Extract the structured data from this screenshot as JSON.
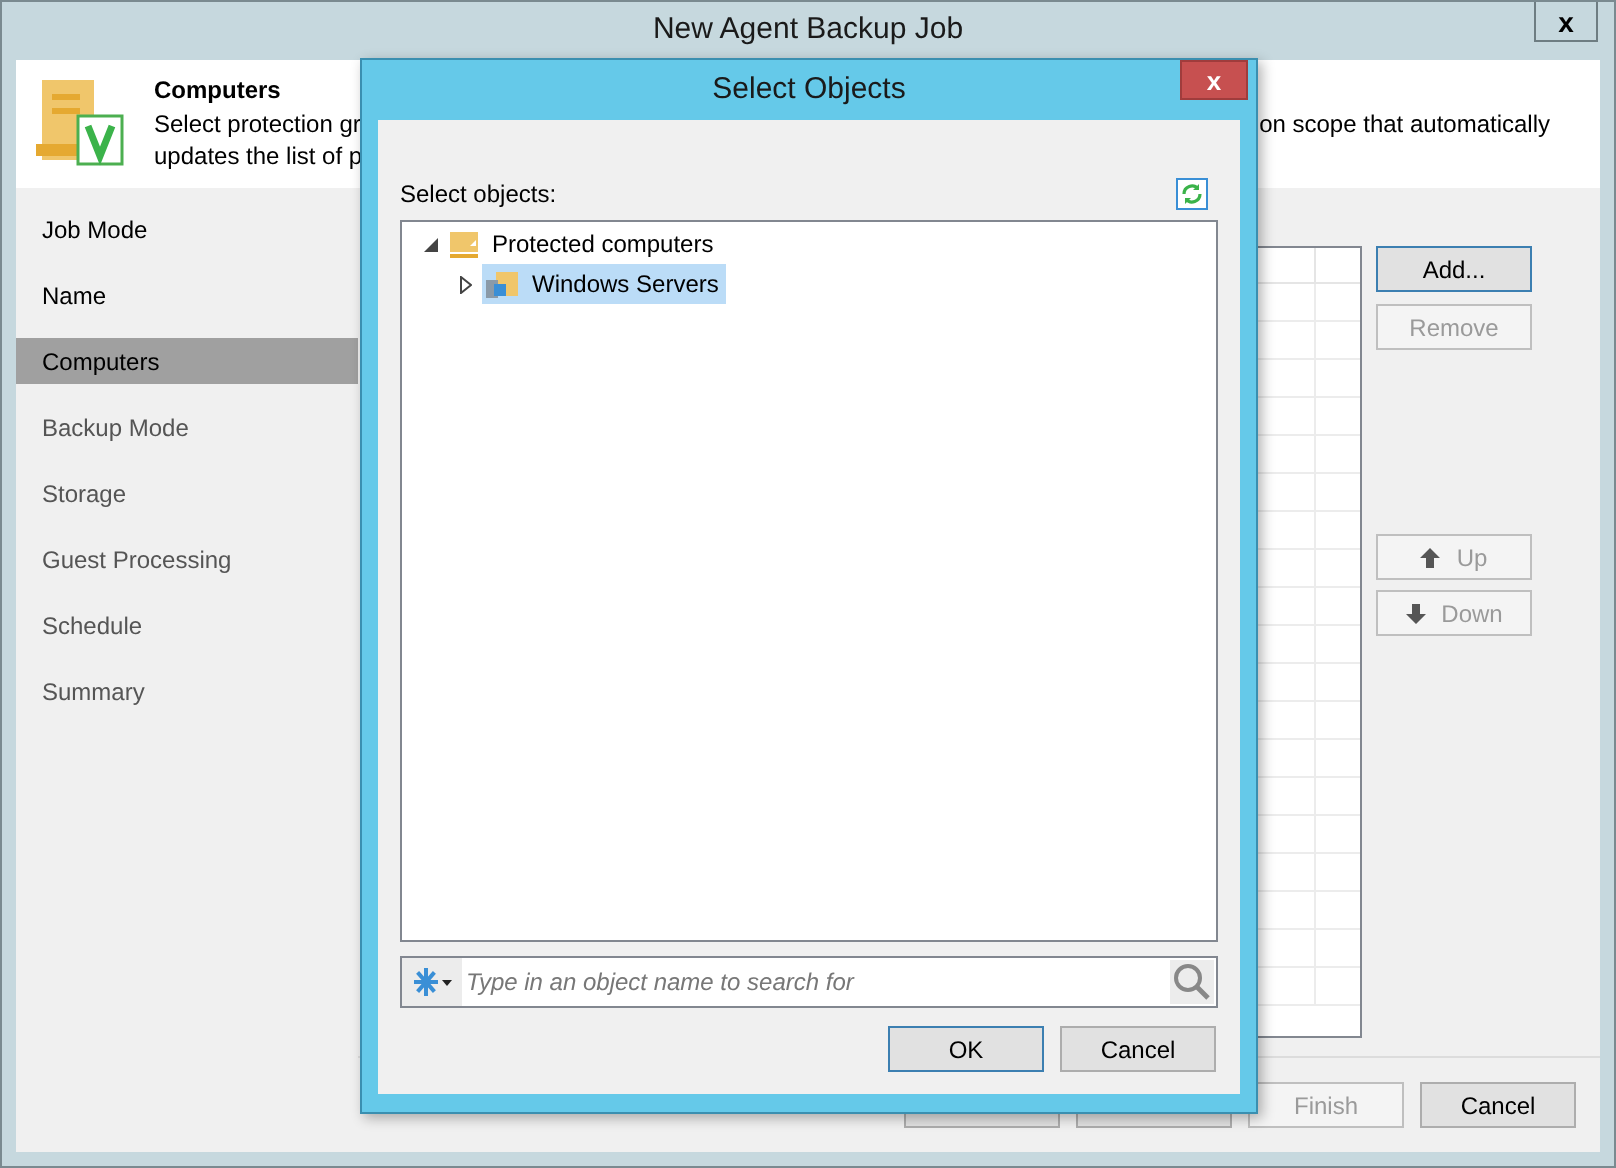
{
  "window": {
    "title": "New Agent Backup Job",
    "close": "x"
  },
  "header": {
    "title": "Computers",
    "description_left": [
      "Select protection gr",
      "updates the list of p"
    ],
    "description_right": "on scope that automatically"
  },
  "steps": [
    {
      "label": "Job Mode",
      "selected": false,
      "disabled": false
    },
    {
      "label": "Name",
      "selected": false,
      "disabled": false
    },
    {
      "label": "Computers",
      "selected": true,
      "disabled": false
    },
    {
      "label": "Backup Mode",
      "selected": false,
      "disabled": true
    },
    {
      "label": "Storage",
      "selected": false,
      "disabled": true
    },
    {
      "label": "Guest Processing",
      "selected": false,
      "disabled": true
    },
    {
      "label": "Schedule",
      "selected": false,
      "disabled": true
    },
    {
      "label": "Summary",
      "selected": false,
      "disabled": true
    }
  ],
  "side_buttons": [
    {
      "kind": "plain",
      "label": "Add...",
      "disabled": false,
      "focused": true
    },
    {
      "kind": "plain",
      "label": "Remove",
      "disabled": true,
      "focused": false
    },
    {
      "kind": "up",
      "label": "Up",
      "disabled": true,
      "focused": false
    },
    {
      "kind": "down",
      "label": "Down",
      "disabled": true,
      "focused": false
    }
  ],
  "footer_buttons": [
    {
      "disabled": false
    },
    {
      "disabled": false
    },
    {
      "label": "Finish",
      "disabled": true
    },
    {
      "label": "Cancel",
      "disabled": false
    }
  ],
  "dialog": {
    "title": "Select Objects",
    "close": "x",
    "label": "Select objects:",
    "tree": [
      {
        "label": "Protected computers",
        "expanded": true,
        "selected": false,
        "children": [
          {
            "label": "Windows Servers",
            "expanded": false,
            "selected": true
          }
        ]
      }
    ],
    "search": {
      "placeholder": "Type in an object name to search for"
    },
    "buttons": [
      {
        "label": "OK",
        "focused": true
      },
      {
        "label": "Cancel",
        "focused": false
      }
    ]
  }
}
